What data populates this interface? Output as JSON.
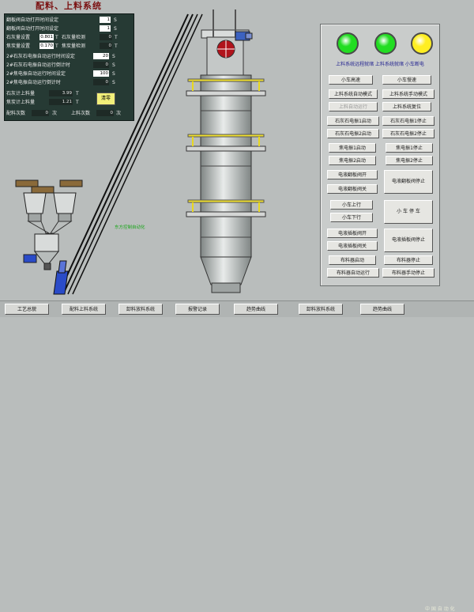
{
  "title": "配料、上料系统",
  "params": [
    {
      "label": "翻板阀自动打开时间设定",
      "value": "1",
      "unit": "S",
      "dark": false
    },
    {
      "label": "翻板阀自动打开时间设定",
      "value": "1",
      "unit": "S",
      "dark": false
    },
    {
      "label": "石灰量设置",
      "value": "0.801",
      "unit": "T",
      "label2": "石灰量检测",
      "value2": "0",
      "unit2": "T",
      "dark": false
    },
    {
      "label": "焦炭量设置",
      "value": "0.170",
      "unit": "T",
      "label2": "焦炭量检测",
      "value2": "0",
      "unit2": "T",
      "dark": false
    },
    {
      "label": "2#石灰石电振自动运行时间设定",
      "value": "20",
      "unit": "S",
      "dark": false
    },
    {
      "label": "2#石灰石电振自动运行倒计时",
      "value": "0",
      "unit": "S",
      "dark": true
    },
    {
      "label": "2#焦电振自动运行时间设定",
      "value": "100",
      "unit": "S",
      "dark": false
    },
    {
      "label": "2#焦电振自动运行倒计时",
      "value": "0",
      "unit": "S",
      "dark": true
    },
    {
      "label": "石灰计上料量",
      "value": "3.99",
      "unit": "T",
      "dark": true
    },
    {
      "label": "焦炭计上料量",
      "value": "1.21",
      "unit": "T",
      "dark": true
    }
  ],
  "clear_button": "清零",
  "batch_count_label": "配料次数",
  "batch_count_value": "0",
  "batch_count_unit": "次",
  "feed_count_label": "上料次数",
  "feed_count_value": "0",
  "feed_count_unit": "次",
  "status_label": "上料系统远程就绪   上料系统就绪   小车断电",
  "lamp_colors": [
    "#22dd22",
    "#22dd22",
    "#ffee22"
  ],
  "buttons": {
    "cart_slow": "小车高速",
    "cart_low": "小车慢速",
    "feed_auto": "上料系统自动模式",
    "feed_manual": "上料系统手动模式",
    "feed_auto_start": "上料自动运行",
    "feed_reset": "上料系统复位",
    "lime1_start": "石灰石电振1启动",
    "lime1_stop": "石灰石电振1停止",
    "lime2_start": "石灰石电振2启动",
    "lime2_stop": "石灰石电振2停止",
    "coke1_start": "焦电振1启动",
    "coke1_stop": "焦电振1停止",
    "coke2_start": "焦电振2启动",
    "coke2_stop": "焦电振2停止",
    "flap_open": "电液翻板阀开",
    "flap_stop": "电液翻板阀停止",
    "flap_close": "电液翻板阀关",
    "cart_up": "小车上行",
    "cart_down": "小车下行",
    "cart_stop": "小 车 停 车",
    "insert_open": "电液插板阀开",
    "insert_stop": "电液插板阀停止",
    "insert_close": "电液插板阀关",
    "dist_start": "布料器启动",
    "dist_stop": "布料器停止",
    "dist_auto": "布料器自动运行",
    "dist_manual": "布料器手动停止"
  },
  "nav": [
    "工艺总貌",
    "配料上料系统",
    "卸料放料系统",
    "报警记录",
    "趋势曲线",
    "卸料放料系统",
    "趋势曲线"
  ],
  "green_note": "东方控制自动化",
  "watermark": "中 国 自 动 化"
}
